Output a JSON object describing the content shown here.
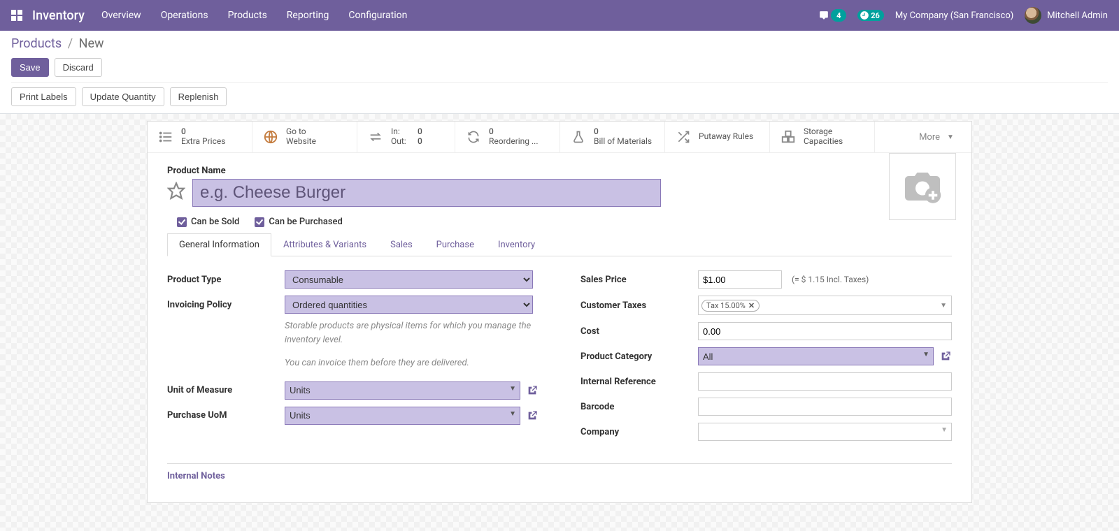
{
  "nav": {
    "brand": "Inventory",
    "menu": [
      "Overview",
      "Operations",
      "Products",
      "Reporting",
      "Configuration"
    ],
    "messages_badge": "4",
    "activities_badge": "26",
    "company": "My Company (San Francisco)",
    "user": "Mitchell Admin"
  },
  "breadcrumb": {
    "parent": "Products",
    "current": "New"
  },
  "cp": {
    "save": "Save",
    "discard": "Discard",
    "buttons": [
      "Print Labels",
      "Update Quantity",
      "Replenish"
    ]
  },
  "stats": {
    "extra_prices": {
      "value": "0",
      "label": "Extra Prices"
    },
    "website": {
      "l1": "Go to",
      "l2": "Website"
    },
    "inout": {
      "in_k": "In:",
      "in_v": "0",
      "out_k": "Out:",
      "out_v": "0"
    },
    "reorder": {
      "value": "0",
      "label": "Reordering ..."
    },
    "bom": {
      "value": "0",
      "label": "Bill of Materials"
    },
    "putaway": "Putaway Rules",
    "storage": {
      "l1": "Storage",
      "l2": "Capacities"
    },
    "more": "More"
  },
  "form": {
    "name_label": "Product Name",
    "name_placeholder": "e.g. Cheese Burger",
    "can_sold": "Can be Sold",
    "can_purchased": "Can be Purchased"
  },
  "tabs": [
    "General Information",
    "Attributes & Variants",
    "Sales",
    "Purchase",
    "Inventory"
  ],
  "left": {
    "product_type_l": "Product Type",
    "product_type_v": "Consumable",
    "invoicing_l": "Invoicing Policy",
    "invoicing_v": "Ordered quantities",
    "help1": "Storable products are physical items for which you manage the inventory level.",
    "help2": "You can invoice them before they are delivered.",
    "uom_l": "Unit of Measure",
    "uom_v": "Units",
    "puom_l": "Purchase UoM",
    "puom_v": "Units"
  },
  "right": {
    "price_l": "Sales Price",
    "price_v": "$1.00",
    "price_note": "(= $ 1.15 Incl. Taxes)",
    "ctax_l": "Customer Taxes",
    "ctax_tag": "Tax 15.00%",
    "cost_l": "Cost",
    "cost_v": "0.00",
    "cat_l": "Product Category",
    "cat_v": "All",
    "ref_l": "Internal Reference",
    "barcode_l": "Barcode",
    "company_l": "Company"
  },
  "notes_header": "Internal Notes"
}
